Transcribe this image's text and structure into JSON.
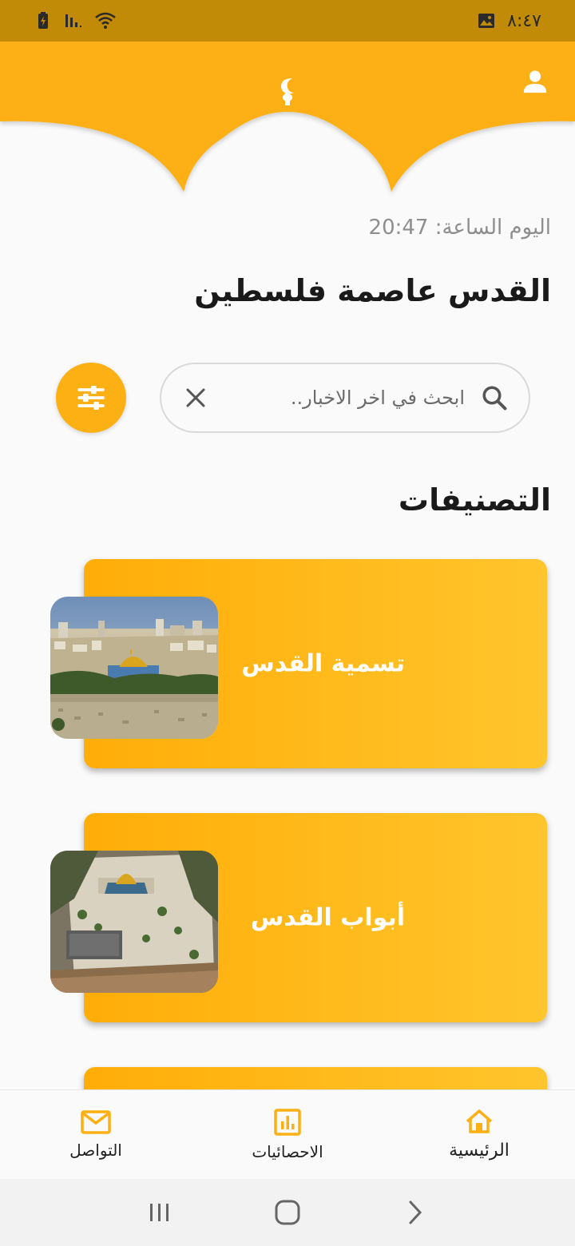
{
  "status_bar": {
    "time": "٨:٤٧"
  },
  "header": {
    "date_label": "اليوم الساعة:",
    "time_value": "20:47",
    "title": "القدس عاصمة فلسطين"
  },
  "search": {
    "placeholder": "ابحث في اخر الاخبار.."
  },
  "categories": {
    "title": "التصنيفات",
    "items": [
      {
        "label": "تسمية القدس"
      },
      {
        "label": "أبواب القدس"
      }
    ]
  },
  "nav": {
    "items": [
      {
        "label": "التواصل",
        "icon": "mail-icon"
      },
      {
        "label": "الاحصائيات",
        "icon": "stats-icon"
      },
      {
        "label": "الرئيسية",
        "icon": "home-icon"
      }
    ]
  },
  "colors": {
    "accent": "#fdb014",
    "status_bar": "#c18a07",
    "card_start": "#ffad08",
    "card_end": "#ffc52c"
  }
}
